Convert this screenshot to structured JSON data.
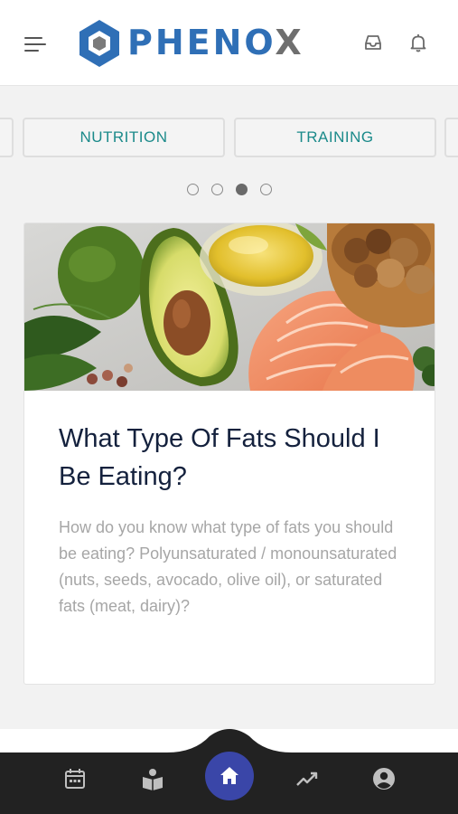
{
  "header": {
    "logo_text": "PHENO",
    "logo_x": "X",
    "menu_icon": "hamburger-menu-icon",
    "inbox_icon": "inbox-icon",
    "bell_icon": "bell-icon"
  },
  "tabs": [
    {
      "label": ""
    },
    {
      "label": "NUTRITION"
    },
    {
      "label": "TRAINING"
    },
    {
      "label": ""
    }
  ],
  "carousel": {
    "page_count": 4,
    "active_index": 2
  },
  "article": {
    "title": "What Type Of Fats Should I Be Eating?",
    "description": "How do you know what type of fats you should be eating? Polyunsaturated / monounsaturated (nuts, seeds, avocado, olive oil), or saturated fats (meat, dairy)?",
    "image": "healthy-fats-food-photo"
  },
  "bottom_nav": {
    "items": [
      "calendar-icon",
      "reading-icon",
      "home-icon",
      "trending-icon",
      "account-icon"
    ],
    "active": "home-icon"
  },
  "colors": {
    "brand_blue": "#2f6fb6",
    "accent_teal": "#1b8a8a",
    "home_button": "#3a46a8",
    "nav_background": "#222222",
    "title_text": "#14213d",
    "body_text": "#a6a6a6"
  }
}
